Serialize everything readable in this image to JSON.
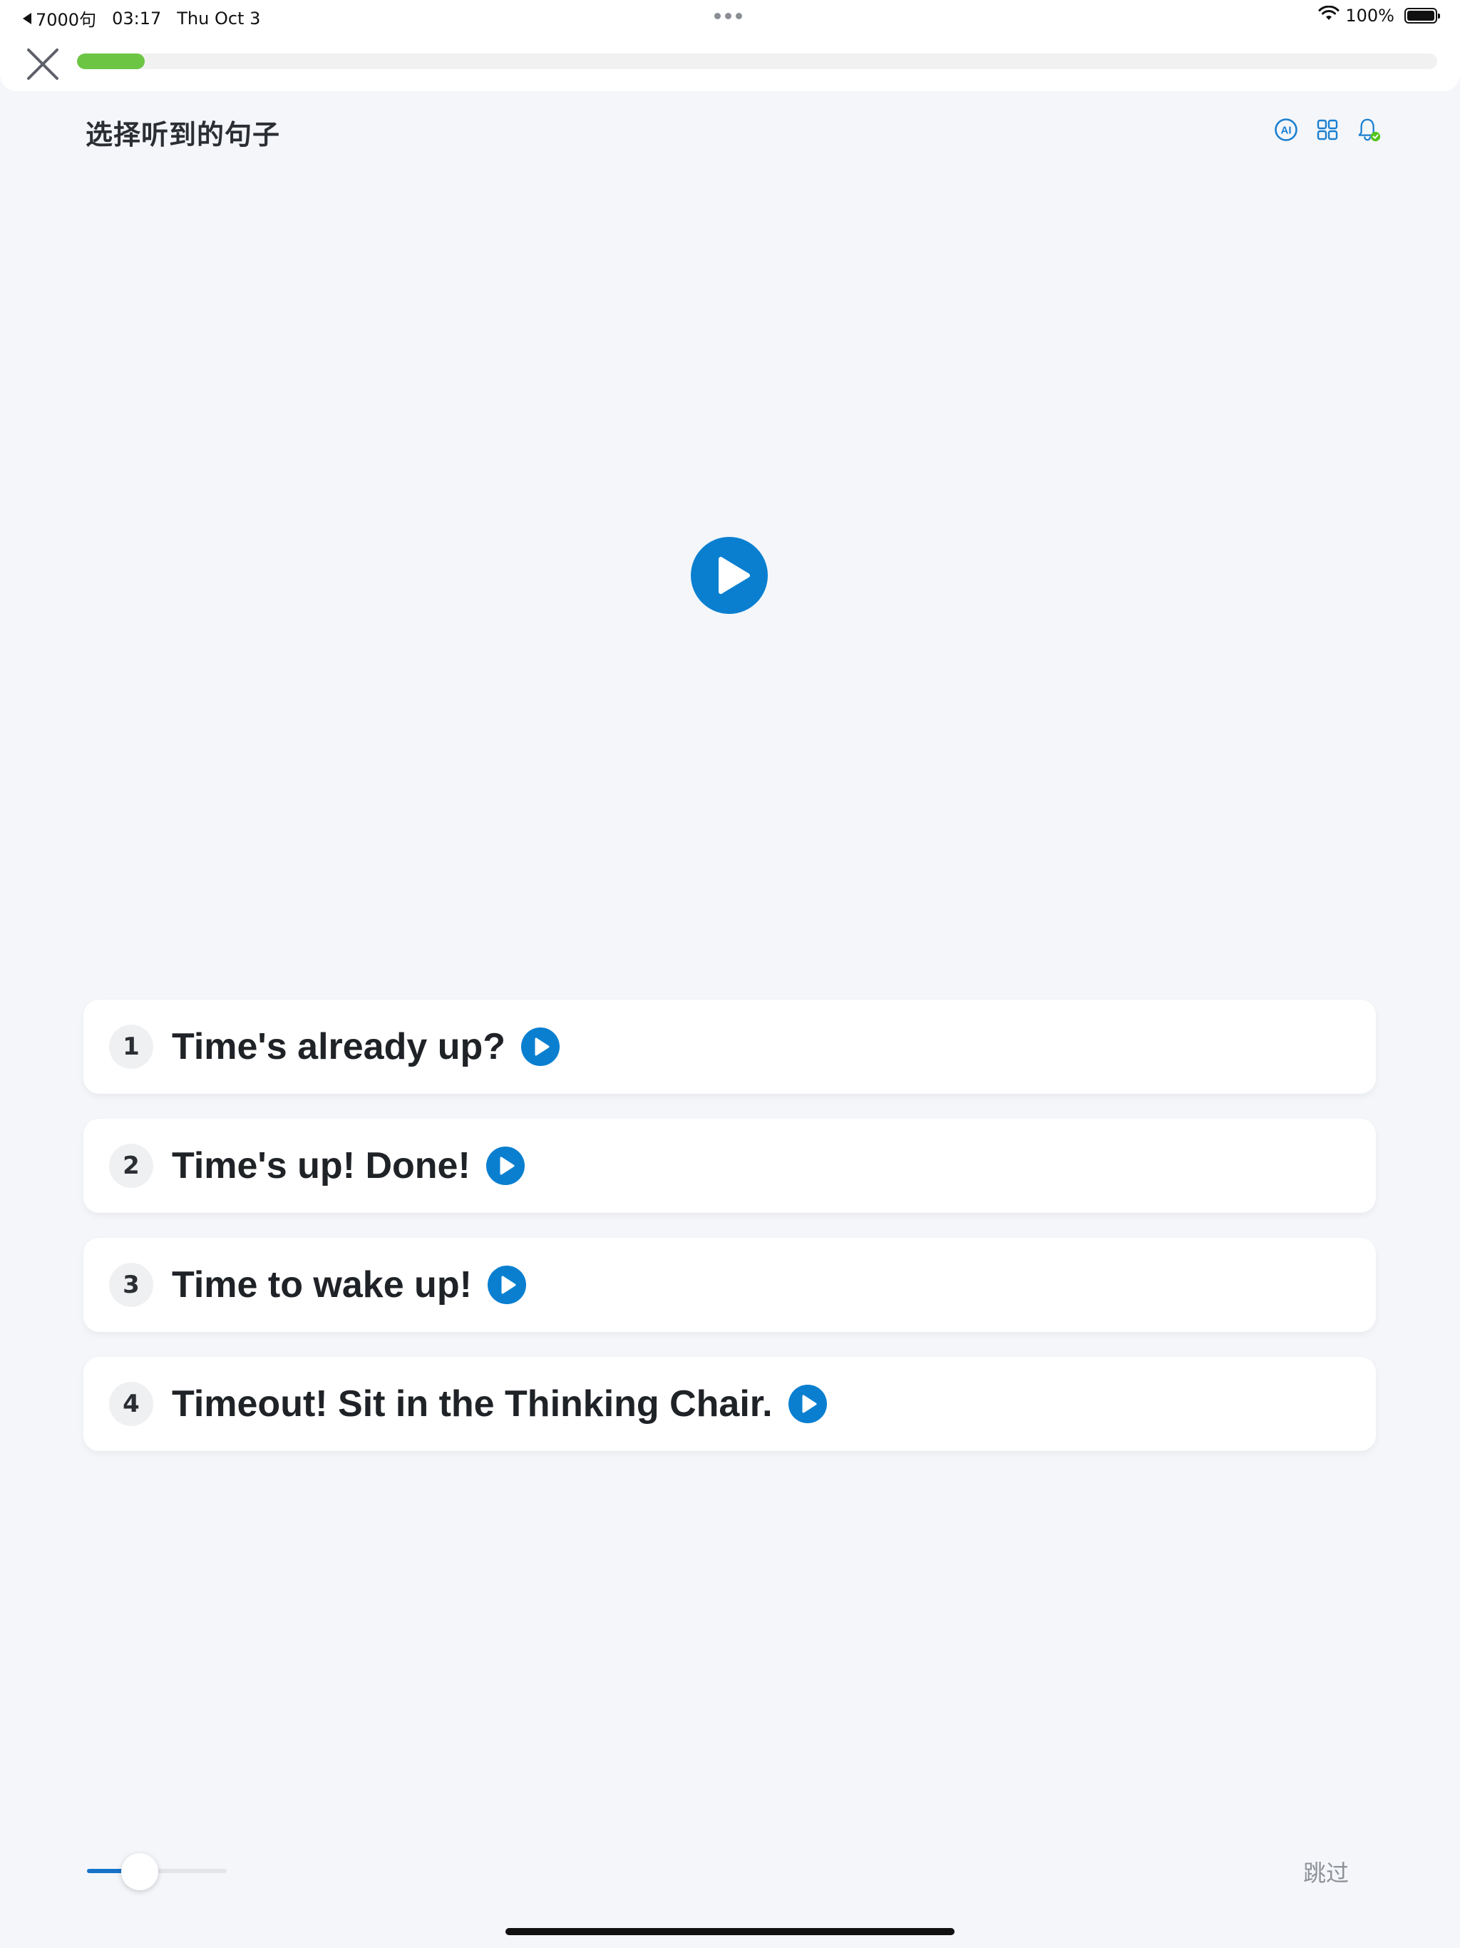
{
  "status_bar": {
    "back_label": "7000句",
    "time": "03:17",
    "date": "Thu Oct 3",
    "battery": "100%"
  },
  "progress": {
    "fraction": 0.05,
    "color": "#6cc644"
  },
  "page": {
    "title": "选择听到的句子"
  },
  "toolbar": {
    "icons": [
      "ai-icon",
      "grid-icon",
      "bell-icon"
    ]
  },
  "options": [
    {
      "number": "1",
      "text": "Time's already up?"
    },
    {
      "number": "2",
      "text": "Time's up! Done!"
    },
    {
      "number": "3",
      "text": "Time to wake up!"
    },
    {
      "number": "4",
      "text": "Timeout! Sit in the Thinking Chair."
    }
  ],
  "speed": {
    "fraction": 0.38
  },
  "footer": {
    "skip_label": "跳过"
  },
  "colors": {
    "accent": "#0a7fd0",
    "progress": "#6cc644",
    "background": "#f4f6fa"
  }
}
